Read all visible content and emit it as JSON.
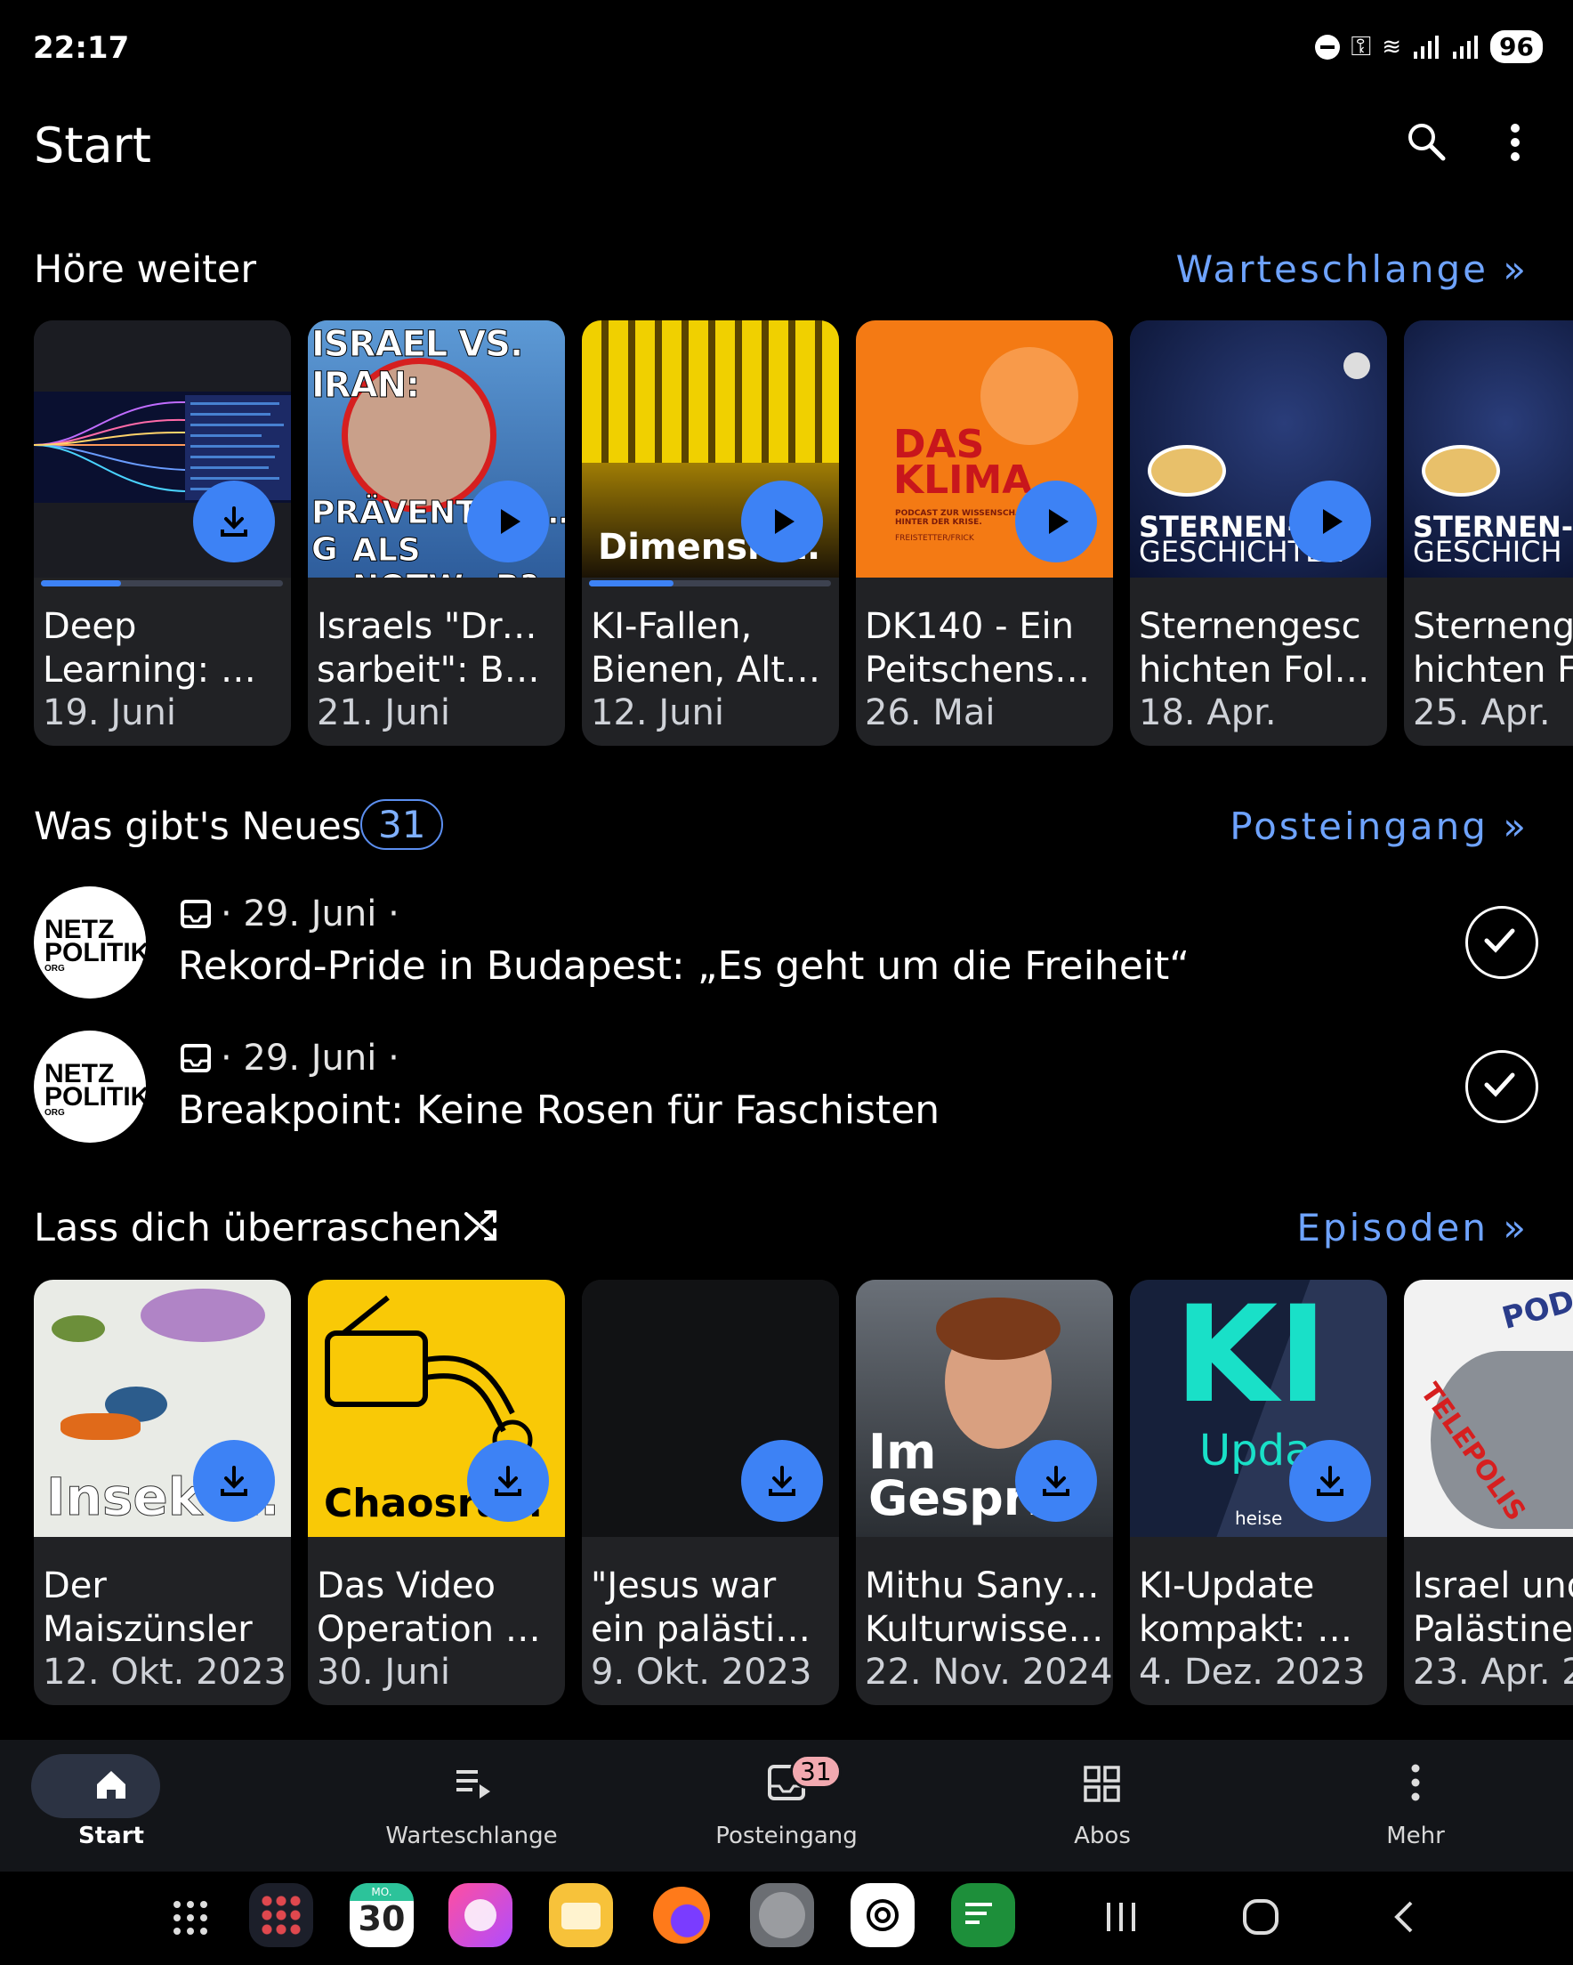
{
  "status": {
    "time": "22:17",
    "battery": "96"
  },
  "app_bar": {
    "title": "Start"
  },
  "continue": {
    "title": "Höre weiter",
    "link": "Warteschlange »",
    "cards": [
      {
        "t1": "Deep",
        "t2": "Learning: De…",
        "date": "19. Juni",
        "progress": 0.45,
        "action": "download"
      },
      {
        "t1": "Israels \"Dreck",
        "t2": "sarbeit\": Bun…",
        "date": "21. Juni",
        "progress": 0,
        "action": "play",
        "art_text1": "ISRAEL VS. IRAN:",
        "art_text2": "PRÄVENTIVS…G",
        "art_text3": "ALS NOTW…R?"
      },
      {
        "t1": "KI-Fallen,",
        "t2": "Bienen, Alter…",
        "date": "12. Juni",
        "progress": 0.35,
        "action": "play",
        "art_text1": "Dimensio…n"
      },
      {
        "t1": "DK140 - Ein",
        "t2": "Peitschensc…",
        "date": "26. Mai",
        "progress": 0,
        "action": "play",
        "art_text1": "DAS",
        "art_text2": "KLIMA",
        "art_text3": "PODCAST ZUR WISSENSCHA HINTER DER KRISE.",
        "art_text4": "FREISTETTER/FRICK"
      },
      {
        "t1": "Sternengesc",
        "t2": "hichten Folg…",
        "date": "18. Apr.",
        "progress": 0,
        "action": "play",
        "art_text1": "STERNEN-",
        "art_text2": "GESCHICHTEN"
      },
      {
        "t1": "Sternenge",
        "t2": "hichten Fo",
        "date": "25. Apr.",
        "progress": 0,
        "action": "none",
        "art_text1": "STERNEN-",
        "art_text2": "GESCHICH"
      }
    ]
  },
  "news": {
    "title": "Was gibt's Neues",
    "count": "31",
    "link": "Posteingang »",
    "items": [
      {
        "meta": "· 29. Juni ·",
        "title": "Rekord-Pride in Budapest: „Es geht um die Freiheit“",
        "logo1": "NETZ",
        "logo2": "POLITIK",
        "logo3": "ORG"
      },
      {
        "meta": "· 29. Juni ·",
        "title": "Breakpoint: Keine Rosen für Faschisten",
        "logo1": "NETZ",
        "logo2": "POLITIK",
        "logo3": "ORG"
      }
    ]
  },
  "surprise": {
    "title": "Lass dich überraschen",
    "link": "Episoden »",
    "cards": [
      {
        "t1": "Der",
        "t2": "Maiszünsler",
        "date": "12. Okt. 2023",
        "art_text1": "Insekt…"
      },
      {
        "t1": "Das Video",
        "t2": "Operation Ce…",
        "date": "30. Juni",
        "art_text1": "Chaosra…"
      },
      {
        "t1": "\"Jesus war",
        "t2": "ein palästine…",
        "date": "9. Okt. 2023"
      },
      {
        "t1": "Mithu Sanyal,",
        "t2": "Kulturwissen…",
        "date": "22. Nov. 2024",
        "art_text1": "Im",
        "art_text2": "Gespr…"
      },
      {
        "t1": "KI-Update",
        "t2": "kompakt: Go…",
        "date": "4. Dez. 2023",
        "art_text1": "KI",
        "art_text2": "Upda…",
        "art_text3": "heise"
      },
      {
        "t1": "Israel und",
        "t2": "Palästiner",
        "date": "23. Apr. 2",
        "art_text1": "TELEPOLIS",
        "art_text2": "POD"
      }
    ]
  },
  "nav": {
    "items": [
      {
        "label": "Start"
      },
      {
        "label": "Warteschlange"
      },
      {
        "label": "Posteingang",
        "badge": "31"
      },
      {
        "label": "Abos"
      },
      {
        "label": "Mehr"
      }
    ]
  },
  "dock": {
    "calendar_day": "30",
    "calendar_month": "MO."
  }
}
